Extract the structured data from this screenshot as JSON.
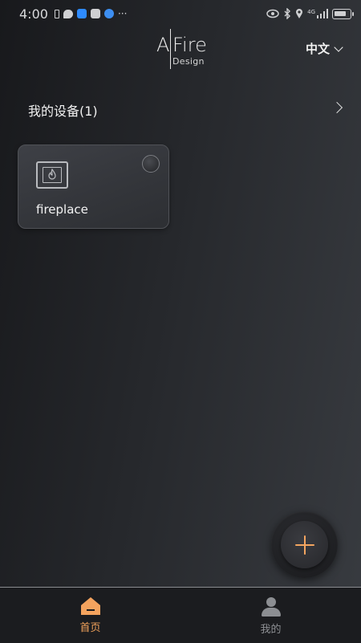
{
  "status_bar": {
    "time": "4:00",
    "more": "···",
    "network": "4G"
  },
  "header": {
    "logo_a": "A",
    "logo_fire": "Fire",
    "logo_design": "Design",
    "language": "中文"
  },
  "devices": {
    "title": "我的设备(1)",
    "items": [
      {
        "name": "fireplace",
        "icon": "fireplace-icon",
        "power": "off"
      }
    ]
  },
  "fab": {
    "icon": "plus-icon",
    "accent": "#f3a560"
  },
  "tabbar": {
    "active": "home",
    "tabs": [
      {
        "label": "首页",
        "icon": "home-icon",
        "color": "#f2a25b"
      },
      {
        "label": "我的",
        "icon": "user-icon",
        "color": "#8d8f93"
      }
    ]
  }
}
